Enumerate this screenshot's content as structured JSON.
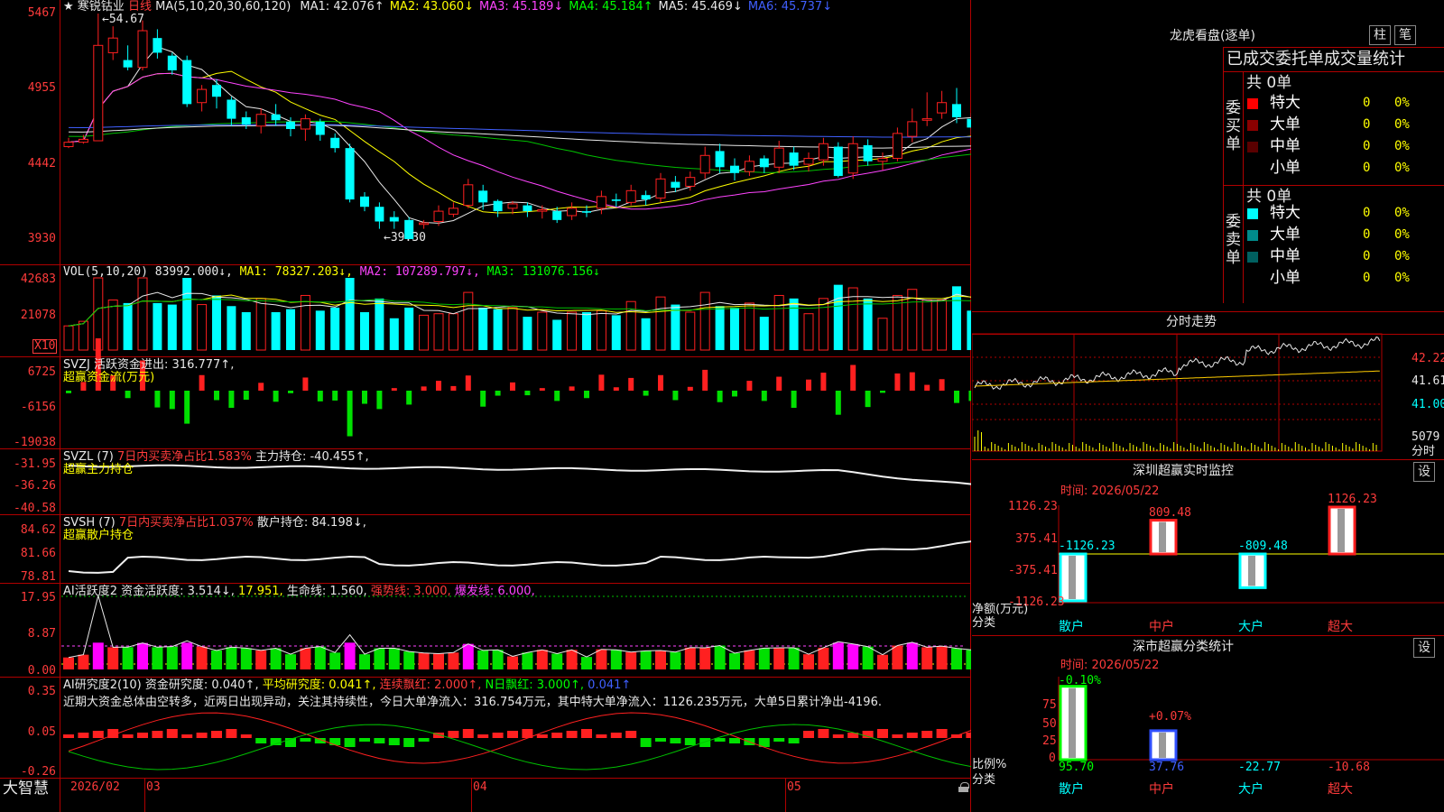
{
  "stock": {
    "star": "★",
    "name": "寒锐钴业",
    "period": "日线"
  },
  "ma_line": {
    "label": "MA(5,10,20,30,60,120)",
    "items": [
      {
        "name": "MA1:",
        "value": "42.076↑",
        "color": "#e8e8e8"
      },
      {
        "name": "MA2:",
        "value": "43.060↓",
        "color": "#ffff00"
      },
      {
        "name": "MA3:",
        "value": "45.189↓",
        "color": "#ff44ff"
      },
      {
        "name": "MA4:",
        "value": "45.184↑",
        "color": "#00ff00"
      },
      {
        "name": "MA5:",
        "value": "45.469↓",
        "color": "#e8e8e8"
      },
      {
        "name": "MA6:",
        "value": "45.737↓",
        "color": "#4060ff"
      }
    ]
  },
  "price_axis": [
    "5467",
    "4955",
    "4442",
    "3930"
  ],
  "price_high_label": "54.67",
  "price_low_label": "39.30",
  "vol": {
    "label": "VOL(5,10,20)",
    "value": "83992.000↓,",
    "ma1": "MA1: 78327.203↓,",
    "ma2": "MA2: 107289.797↓,",
    "ma3": "MA3: 131076.156↓",
    "axis": [
      "42683",
      "21078"
    ],
    "unit": "X10"
  },
  "svzj": {
    "label": "SVZJ",
    "text": "活跃资金进出: 316.777↑,",
    "sub": "超赢资金流(万元)",
    "axis": [
      "6725",
      "-6156",
      "-19038"
    ]
  },
  "svzl": {
    "label": "SVZL (7)",
    "text1": "7日内买卖净占比1.583%",
    "text2": "主力持仓: -40.455↑,",
    "sub": "超赢主力持仓",
    "axis": [
      "-31.95",
      "-36.26",
      "-40.58"
    ]
  },
  "svsh": {
    "label": "SVSH (7)",
    "text1": "7日内买卖净占比1.037%",
    "text2": "散户持仓: 84.198↓,",
    "sub": "超赢散户持仓",
    "axis": [
      "84.62",
      "81.66",
      "78.81"
    ]
  },
  "ai_active": {
    "label": "AI活跃度2",
    "t1": "资金活跃度: 3.514↓,",
    "t2": "17.951,",
    "t3": "生命线: 1.560,",
    "t4": "强势线: 3.000,",
    "t5": "爆发线: 6.000,",
    "axis": [
      "17.95",
      "8.87",
      "0.00"
    ]
  },
  "ai_research": {
    "label": "AI研究度2(10)",
    "t1": "资金研究度: 0.040↑,",
    "t2": "平均研究度: 0.041↑,",
    "t3": "连续飘红: 2.000↑,",
    "t4": "N日飘红: 3.000↑,",
    "t5": "0.041↑",
    "comment": "近期大资金总体由空转多，近两日出现异动，关注其持续性，今日大单净流入：316.754万元，其中特大单净流入：1126.235万元，大单5日累计净出-4196.",
    "axis": [
      "0.35",
      "0.05",
      "-0.26"
    ]
  },
  "bottom_bar": {
    "brand": "大智慧",
    "months": [
      "2026/02",
      "03",
      "04",
      "05"
    ]
  },
  "right": {
    "longhu_title": "龙虎看盘(逐单)",
    "btn_zhu": "柱",
    "btn_bi": "笔",
    "stat_title": "已成交委托单成交量统计",
    "buy_group": "委买单",
    "sell_group": "委卖单",
    "buy_total": "共 0单",
    "sell_total": "共 0单",
    "buy_rows": [
      {
        "label": "特大",
        "count": "0",
        "pct": "0%",
        "color": "#ff0000"
      },
      {
        "label": "大单",
        "count": "0",
        "pct": "0%",
        "color": "#8b0000"
      },
      {
        "label": "中单",
        "count": "0",
        "pct": "0%",
        "color": "#5a0000"
      },
      {
        "label": "小单",
        "count": "0",
        "pct": "0%",
        "color": ""
      }
    ],
    "sell_rows": [
      {
        "label": "特大",
        "count": "0",
        "pct": "0%",
        "color": "#00ffff"
      },
      {
        "label": "大单",
        "count": "0",
        "pct": "0%",
        "color": "#008b8b"
      },
      {
        "label": "中单",
        "count": "0",
        "pct": "0%",
        "color": "#006060"
      },
      {
        "label": "小单",
        "count": "0",
        "pct": "0%",
        "color": ""
      }
    ],
    "fenshi_title": "分时走势",
    "fenshi_axis": [
      "42.22",
      "41.61",
      "41.00"
    ],
    "fenshi_vol": "5079",
    "fenshi_vol_unit": "分时",
    "sz_monitor_title": "深圳超赢实时监控",
    "sz_btn": "设",
    "sz_time": "时间: 2026/05/22",
    "sz_axis": [
      "1126.23",
      "375.41",
      "-375.41",
      "-1126.23"
    ],
    "sz_axis_label": "净额(万元)",
    "sz_cat_label": "分类",
    "sz_bars": [
      {
        "cat": "散户",
        "value": -1126.23,
        "label": "-1126.23"
      },
      {
        "cat": "中户",
        "value": 809.48,
        "label": "809.48"
      },
      {
        "cat": "大户",
        "value": -809.48,
        "label": "-809.48"
      },
      {
        "cat": "超大",
        "value": 1126.23,
        "label": "1126.23"
      }
    ],
    "cls_title": "深市超赢分类统计",
    "cls_btn": "设",
    "cls_time": "时间: 2026/05/22",
    "cls_axis": [
      "75",
      "50",
      "25",
      "0"
    ],
    "cls_axis_label": "比例%",
    "cls_cat_label": "分类",
    "cls_bars": [
      {
        "cat": "散户",
        "value": 95.7,
        "label": "95.70",
        "top": "-0.10%"
      },
      {
        "cat": "中户",
        "value": 37.76,
        "label": "37.76",
        "top": "+0.07%"
      },
      {
        "cat": "大户",
        "value": -22.77,
        "label": "-22.77",
        "top": ""
      },
      {
        "cat": "超大",
        "value": -10.68,
        "label": "-10.68",
        "top": ""
      }
    ]
  },
  "chart_data": {
    "type": "candlestick",
    "candles": [
      [
        45.6,
        45.9,
        46.2,
        45.5
      ],
      [
        45.9,
        46.1,
        46.4,
        45.8
      ],
      [
        46.0,
        52.5,
        54.67,
        46.0
      ],
      [
        52.0,
        53.0,
        53.8,
        51.5
      ],
      [
        51.5,
        51.0,
        52.5,
        50.8
      ],
      [
        51.0,
        53.5,
        54.2,
        50.8
      ],
      [
        53.0,
        52.0,
        53.6,
        51.6
      ],
      [
        51.8,
        50.8,
        52.0,
        50.5
      ],
      [
        51.5,
        48.5,
        51.8,
        48.3
      ],
      [
        48.6,
        49.5,
        49.8,
        48.0
      ],
      [
        49.8,
        49.0,
        50.2,
        48.2
      ],
      [
        48.8,
        47.5,
        49.0,
        47.0
      ],
      [
        47.6,
        47.1,
        48.0,
        46.8
      ],
      [
        47.0,
        47.8,
        48.2,
        46.5
      ],
      [
        47.8,
        47.4,
        48.5,
        47.0
      ],
      [
        47.3,
        46.8,
        47.6,
        46.3
      ],
      [
        46.8,
        47.5,
        47.8,
        46.0
      ],
      [
        47.3,
        46.4,
        47.5,
        46.0
      ],
      [
        46.2,
        45.5,
        46.5,
        45.2
      ],
      [
        45.5,
        42.0,
        45.8,
        41.8
      ],
      [
        42.2,
        41.5,
        42.5,
        41.2
      ],
      [
        41.5,
        40.5,
        41.8,
        40.0
      ],
      [
        40.8,
        40.5,
        41.2,
        40.0
      ],
      [
        40.6,
        39.3,
        40.8,
        39.3
      ],
      [
        40.3,
        40.4,
        40.6,
        40.0
      ],
      [
        40.5,
        41.2,
        41.6,
        40.2
      ],
      [
        41.0,
        41.4,
        41.8,
        40.8
      ],
      [
        41.6,
        43.0,
        43.4,
        41.4
      ],
      [
        42.6,
        41.8,
        43.0,
        41.3
      ],
      [
        41.9,
        41.2,
        42.0,
        40.8
      ],
      [
        41.4,
        41.7,
        41.9,
        41.0
      ],
      [
        41.6,
        41.2,
        41.8,
        40.8
      ],
      [
        41.2,
        41.3,
        41.6,
        40.7
      ],
      [
        41.2,
        40.6,
        41.5,
        40.4
      ],
      [
        40.9,
        41.4,
        41.8,
        40.6
      ],
      [
        41.2,
        41.1,
        41.6,
        40.8
      ],
      [
        41.4,
        42.2,
        42.6,
        41.0
      ],
      [
        42.0,
        41.9,
        42.4,
        41.5
      ],
      [
        41.8,
        42.6,
        43.0,
        41.6
      ],
      [
        42.3,
        42.0,
        42.6,
        41.6
      ],
      [
        42.1,
        43.4,
        43.8,
        41.8
      ],
      [
        43.2,
        42.8,
        43.6,
        42.5
      ],
      [
        42.9,
        43.5,
        43.9,
        42.6
      ],
      [
        43.8,
        45.0,
        45.6,
        43.4
      ],
      [
        45.3,
        44.2,
        45.8,
        43.8
      ],
      [
        44.3,
        43.8,
        44.8,
        43.3
      ],
      [
        43.9,
        44.6,
        45.0,
        43.6
      ],
      [
        44.8,
        44.2,
        45.0,
        43.8
      ],
      [
        44.2,
        45.5,
        46.0,
        43.8
      ],
      [
        45.2,
        44.3,
        45.6,
        44.0
      ],
      [
        44.4,
        44.8,
        45.2,
        43.9
      ],
      [
        44.7,
        45.8,
        46.2,
        44.3
      ],
      [
        45.6,
        43.6,
        45.9,
        43.5
      ],
      [
        43.8,
        45.8,
        46.3,
        43.4
      ],
      [
        45.7,
        44.6,
        46.1,
        44.3
      ],
      [
        44.6,
        44.8,
        45.2,
        44.0
      ],
      [
        44.8,
        46.5,
        46.9,
        44.6
      ],
      [
        46.3,
        47.3,
        48.2,
        45.9
      ],
      [
        47.4,
        47.5,
        49.3,
        47.0
      ],
      [
        47.9,
        48.6,
        49.4,
        47.5
      ],
      [
        48.5,
        47.6,
        49.6,
        47.2
      ],
      [
        47.5,
        46.9,
        47.9,
        46.4
      ],
      [
        47.1,
        46.7,
        47.8,
        46.3
      ],
      [
        46.6,
        46.4,
        47.1,
        46.0
      ],
      [
        46.0,
        43.0,
        46.5,
        42.8
      ],
      [
        42.8,
        43.5,
        43.8,
        42.3
      ],
      [
        43.5,
        42.5,
        43.8,
        41.8
      ],
      [
        42.7,
        40.8,
        43.0,
        40.5
      ],
      [
        40.9,
        40.8,
        41.4,
        40.0
      ],
      [
        40.8,
        40.0,
        41.2,
        39.8
      ],
      [
        40.2,
        40.8,
        41.2,
        39.9
      ],
      [
        40.4,
        41.1,
        41.5,
        40.0
      ],
      [
        40.8,
        40.9,
        41.5,
        40.2
      ],
      [
        40.9,
        40.5,
        41.2,
        40.0
      ],
      [
        40.6,
        41.4,
        42.0,
        40.2
      ],
      [
        41.3,
        42.1,
        42.5,
        41.0
      ]
    ]
  }
}
